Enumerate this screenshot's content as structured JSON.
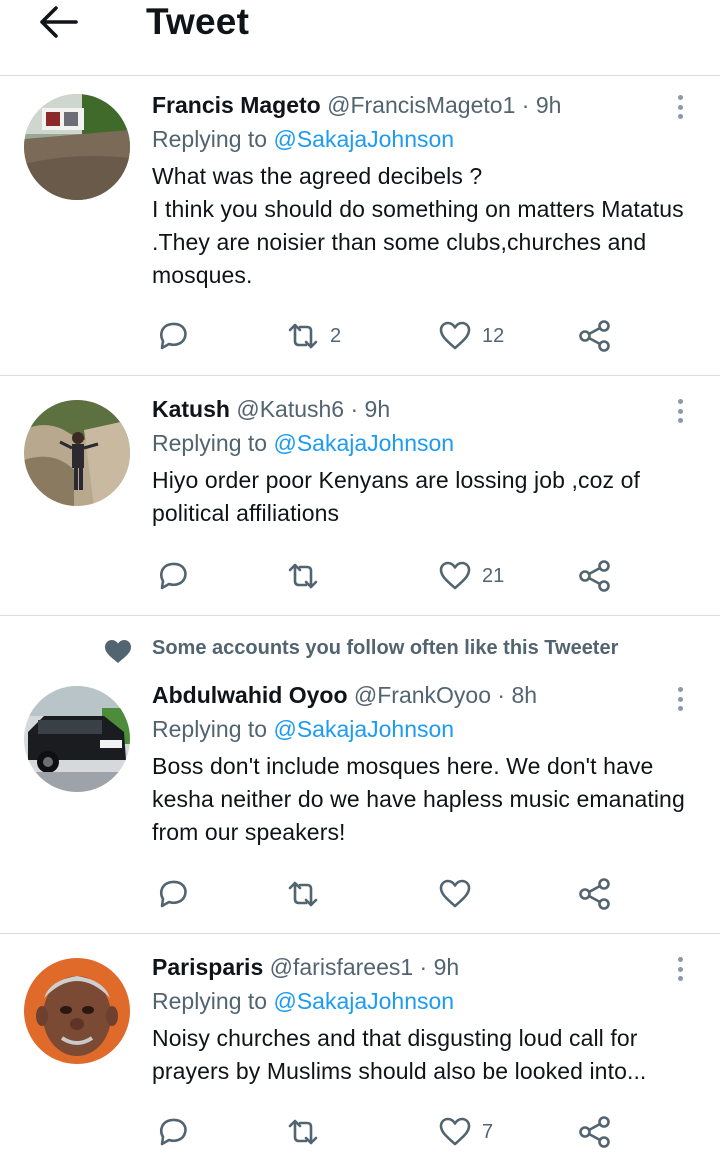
{
  "header": {
    "title": "Tweet",
    "back_icon": "arrow-left-icon"
  },
  "tweets": [
    {
      "name": "Francis Mageto",
      "handle": "@FrancisMageto1",
      "time": " · 9h",
      "replying_prefix": "Replying to ",
      "replying_to": "@SakajaJohnson",
      "text": "What was the agreed decibels ?\nI think you should do something on matters Matatus .They are noisier than some clubs,churches and mosques.",
      "retweets": "2",
      "likes": "12"
    },
    {
      "name": "Katush",
      "handle": "@Katush6",
      "time": " · 9h",
      "replying_prefix": "Replying to ",
      "replying_to": "@SakajaJohnson",
      "text": "Hiyo order poor Kenyans are lossing job ,coz of political affiliations",
      "retweets": "",
      "likes": "21"
    },
    {
      "social_context": "Some accounts you follow often like this Tweeter",
      "name": "Abdulwahid Oyoo",
      "handle": "@FrankOyoo",
      "time": " · 8h",
      "replying_prefix": "Replying to ",
      "replying_to": "@SakajaJohnson",
      "text": "Boss don't include mosques here.  We don't have kesha neither do we have hapless music emanating from our speakers!",
      "retweets": "",
      "likes": ""
    },
    {
      "name": "Parisparis",
      "handle": "@farisfarees1",
      "time": " · 9h",
      "replying_prefix": "Replying to ",
      "replying_to": "@SakajaJohnson",
      "text": "Noisy churches and that disgusting loud call for prayers  by Muslims should also be looked into...",
      "retweets": "",
      "likes": "7"
    }
  ],
  "colors": {
    "link": "#1d9bf0",
    "secondary_text": "#536471",
    "divider": "#d9dde1",
    "primary_text": "#0f1419"
  }
}
